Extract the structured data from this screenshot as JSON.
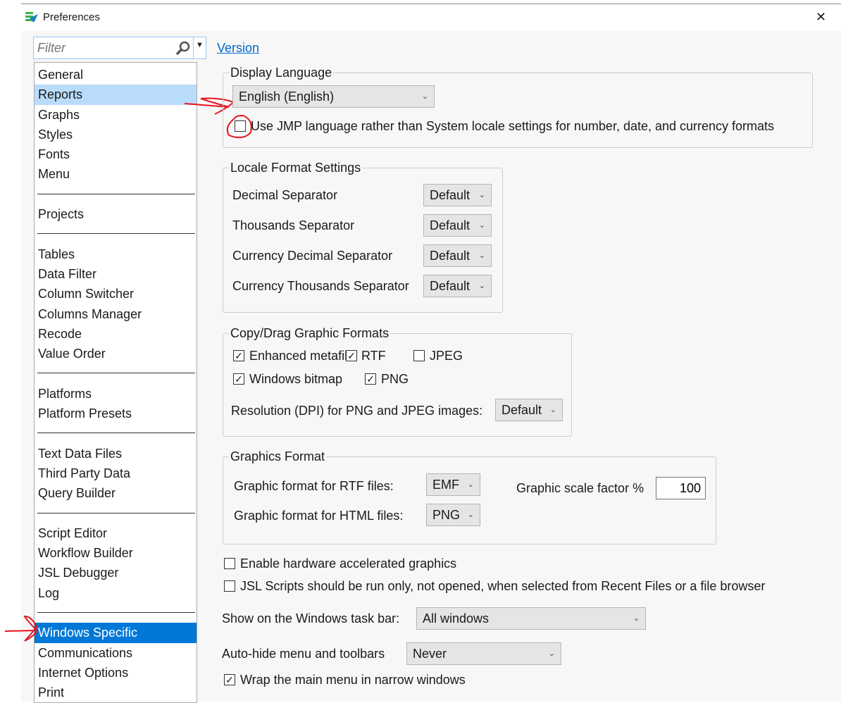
{
  "window": {
    "title": "Preferences",
    "close": "✕"
  },
  "filter": {
    "placeholder": "Filter"
  },
  "version_link": "Version",
  "sidebar": {
    "groups": [
      [
        "General",
        "Reports",
        "Graphs",
        "Styles",
        "Fonts",
        "Menu"
      ],
      [
        "Projects"
      ],
      [
        "Tables",
        "Data Filter",
        "Column Switcher",
        "Columns Manager",
        "Recode",
        "Value Order"
      ],
      [
        "Platforms",
        "Platform Presets"
      ],
      [
        "Text Data Files",
        "Third Party Data",
        "Query Builder"
      ],
      [
        "Script Editor",
        "Workflow Builder",
        "JSL Debugger",
        "Log"
      ],
      [
        "Windows Specific",
        "Communications",
        "Internet Options",
        "Print"
      ]
    ],
    "hover": "Reports",
    "selected": "Windows Specific"
  },
  "display_language": {
    "title": "Display Language",
    "value": "English (English)",
    "checkbox_label": "Use JMP language rather than System locale settings for number, date, and currency formats",
    "checked": false
  },
  "locale": {
    "title": "Locale Format Settings",
    "rows": [
      {
        "label": "Decimal Separator",
        "value": "Default"
      },
      {
        "label": "Thousands Separator",
        "value": "Default"
      },
      {
        "label": "Currency Decimal Separator",
        "value": "Default"
      },
      {
        "label": "Currency Thousands Separator",
        "value": "Default"
      }
    ]
  },
  "copy_drag": {
    "title": "Copy/Drag Graphic Formats",
    "emf": "Enhanced metafile",
    "rtf": "RTF",
    "jpeg": "JPEG",
    "bmp": "Windows bitmap",
    "png": "PNG",
    "checks": {
      "emf": true,
      "rtf": true,
      "jpeg": false,
      "bmp": true,
      "png": true
    },
    "dpi_label": "Resolution (DPI) for PNG and JPEG images:",
    "dpi_value": "Default"
  },
  "graphics_format": {
    "title": "Graphics Format",
    "rtf_label": "Graphic format for RTF files:",
    "rtf_value": "EMF",
    "html_label": "Graphic format for HTML files:",
    "html_value": "PNG",
    "scale_label": "Graphic scale factor %",
    "scale_value": "100"
  },
  "options": {
    "hw_accel": "Enable hardware accelerated graphics",
    "jsl_run": "JSL Scripts should be run only, not opened, when selected from Recent Files or a file browser",
    "taskbar_label": "Show on the Windows task bar:",
    "taskbar_value": "All windows",
    "autohide_label": "Auto-hide menu and toolbars",
    "autohide_value": "Never",
    "wrap_menu": "Wrap the main menu in narrow windows"
  },
  "colors": {
    "selection": "#0078d7",
    "hover": "#b9dcfb",
    "link": "#0066cc",
    "annotation": "#e8141e"
  }
}
